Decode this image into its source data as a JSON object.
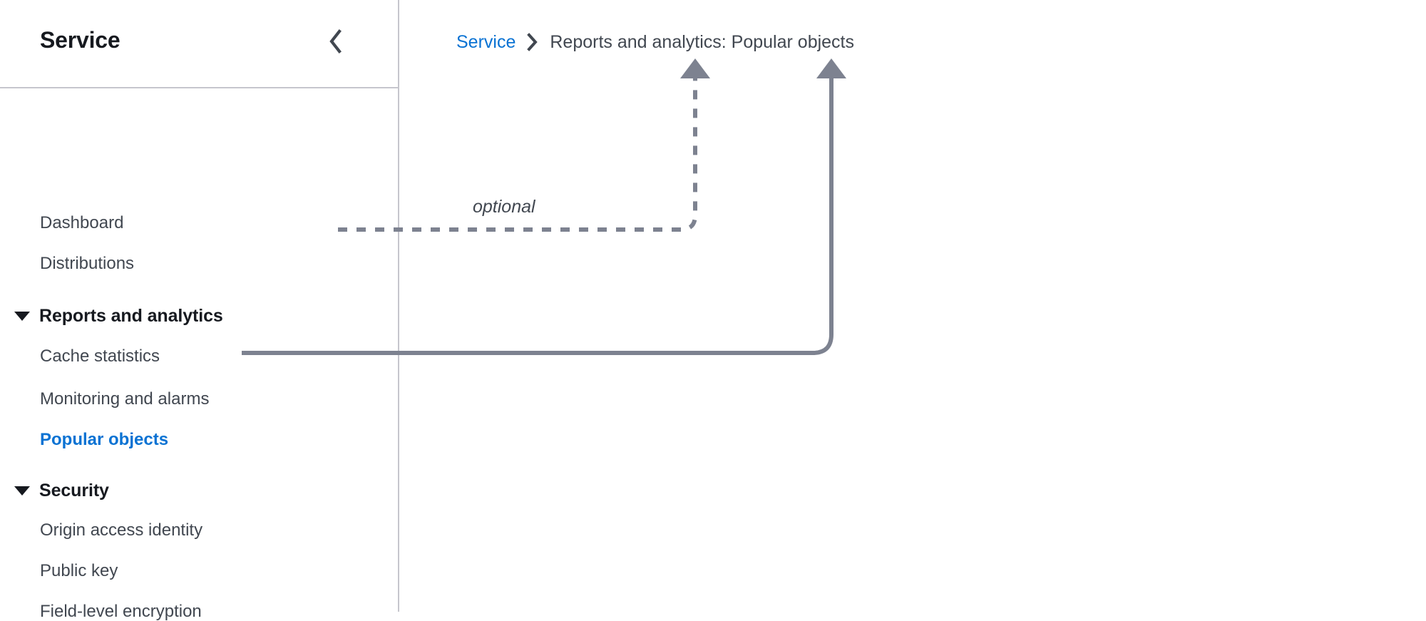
{
  "side_nav": {
    "title": "Service",
    "collapse_icon": "chevron-left-icon",
    "items": [
      {
        "label": "Dashboard",
        "type": "link",
        "selected": false
      },
      {
        "label": "Distributions",
        "type": "link",
        "selected": false
      },
      {
        "label": "Reports and analytics",
        "type": "section",
        "expanded": true,
        "caret_icon": "caret-down-icon"
      },
      {
        "label": "Cache statistics",
        "type": "link",
        "selected": false
      },
      {
        "label": "Monitoring and alarms",
        "type": "link",
        "selected": false
      },
      {
        "label": "Popular objects",
        "type": "link",
        "selected": true
      },
      {
        "label": "Security",
        "type": "section",
        "expanded": true,
        "caret_icon": "caret-down-icon"
      },
      {
        "label": "Origin access identity",
        "type": "link",
        "selected": false
      },
      {
        "label": "Public key",
        "type": "link",
        "selected": false
      },
      {
        "label": "Field-level encryption",
        "type": "link",
        "selected": false
      }
    ]
  },
  "content": {
    "breadcrumb": {
      "root_label": "Service",
      "separator_icon": "chevron-right-icon",
      "current_label": "Reports and analytics: Popular objects"
    }
  },
  "annotations": {
    "optional_label": "optional",
    "arrow_color": "#7d8290",
    "dashed_arrow_name": "optional-section-to-breadcrumb-arrow",
    "solid_arrow_name": "selected-item-to-breadcrumb-arrow"
  },
  "colors": {
    "link_blue": "#0972d3",
    "text_dark": "#16191f",
    "text_body": "#414750",
    "divider": "#c6c6cd",
    "annotation_gray": "#7d8290"
  }
}
